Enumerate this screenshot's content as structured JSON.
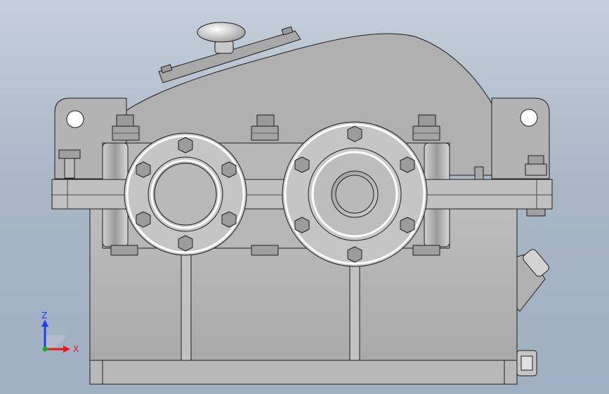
{
  "viewport": {
    "background_top": "#c5cfdb",
    "background_bottom": "#9fb0c2"
  },
  "model": {
    "body_color": "#b4b4b4",
    "cover_color": "#a9a9a9",
    "flange_color": "#c8c8c8",
    "bolt_color": "#8a8a8a",
    "edge_color": "#1e1e1e"
  },
  "triad": {
    "z_label": "Z",
    "x_label": "X",
    "z_color": "#1a3cff",
    "x_color": "#e81818",
    "y_color": "#19b019"
  }
}
